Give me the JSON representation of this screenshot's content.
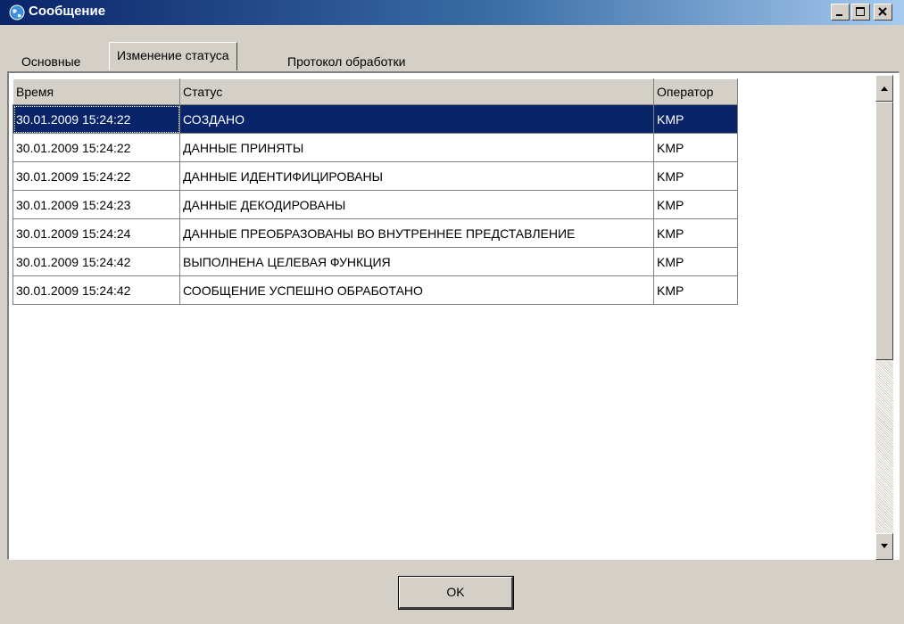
{
  "window": {
    "title": "Сообщение",
    "title_icon": "globe-icon"
  },
  "window_buttons": [
    "minimize-icon",
    "maximize-icon",
    "close-icon"
  ],
  "tabs": [
    {
      "label": "Основные",
      "active": false
    },
    {
      "label": "Изменение статуса",
      "active": true
    },
    {
      "label": "Протокол обработки",
      "active": false
    }
  ],
  "table": {
    "columns": [
      "Время",
      "Статус",
      "Оператор"
    ],
    "rows": [
      {
        "time": "30.01.2009 15:24:22",
        "status": "СОЗДАНО",
        "operator": "KMP",
        "selected": true
      },
      {
        "time": "30.01.2009 15:24:22",
        "status": "ДАННЫЕ ПРИНЯТЫ",
        "operator": "KMP"
      },
      {
        "time": "30.01.2009 15:24:22",
        "status": "ДАННЫЕ ИДЕНТИФИЦИРОВАНЫ",
        "operator": "KMP"
      },
      {
        "time": "30.01.2009 15:24:23",
        "status": "ДАННЫЕ ДЕКОДИРОВАНЫ",
        "operator": "KMP"
      },
      {
        "time": "30.01.2009 15:24:24",
        "status": "ДАННЫЕ ПРЕОБРАЗОВАНЫ ВО ВНУТРЕННЕЕ ПРЕДСТАВЛЕНИЕ",
        "operator": "KMP"
      },
      {
        "time": "30.01.2009 15:24:42",
        "status": "ВЫПОЛНЕНА ЦЕЛЕВАЯ ФУНКЦИЯ",
        "operator": "KMP"
      },
      {
        "time": "30.01.2009 15:24:42",
        "status": "СООБЩЕНИЕ УСПЕШНО ОБРАБОТАНО",
        "operator": "KMP"
      }
    ]
  },
  "ok_button": {
    "label": "OK"
  },
  "colors": {
    "titlebar": "#0a246a",
    "selection": "#0a246a",
    "face": "#d4d0c8"
  }
}
